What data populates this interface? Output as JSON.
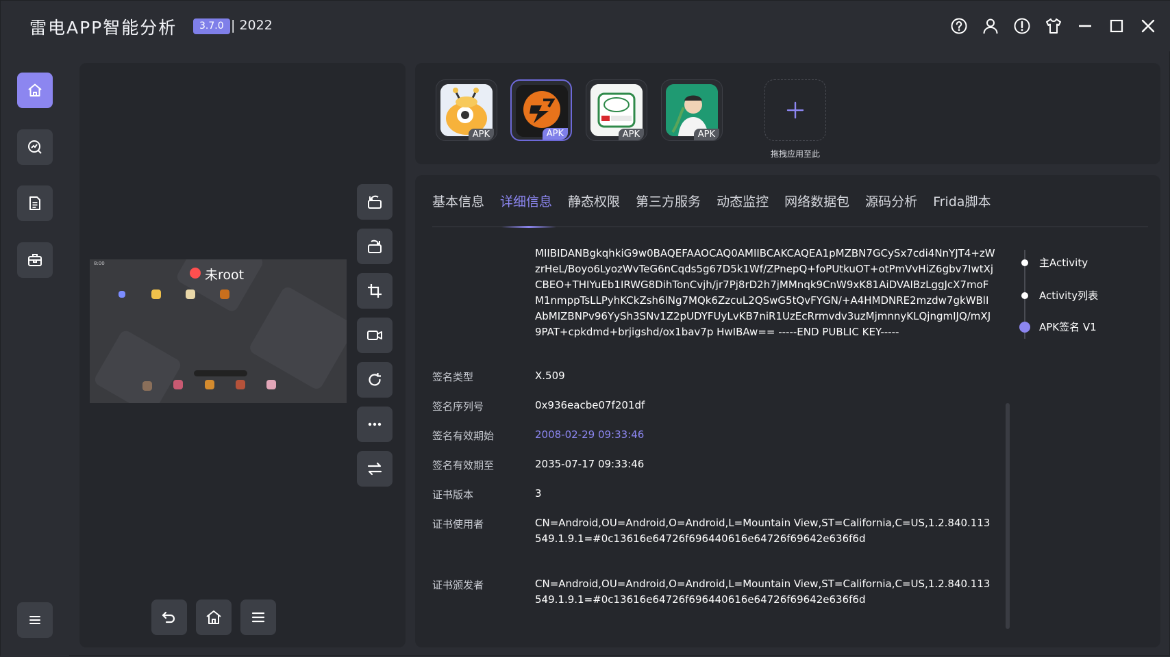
{
  "titlebar": {
    "title": "雷电APP智能分析",
    "version": "3.7.0",
    "year": "| 2022"
  },
  "sidebar": {
    "items": [
      {
        "icon": "home-icon",
        "active": true
      },
      {
        "icon": "analysis-icon",
        "active": false
      },
      {
        "icon": "document-icon",
        "active": false
      },
      {
        "icon": "toolbox-icon",
        "active": false
      }
    ],
    "menu_icon": "menu-icon"
  },
  "device": {
    "root_status": "未root",
    "status_bar_time": "8:00",
    "tools": [
      "rotate-left-icon",
      "rotate-right-icon",
      "crop-icon",
      "record-icon",
      "refresh-icon",
      "more-icon",
      "switch-icon"
    ],
    "nav": [
      "back-icon",
      "home-icon",
      "menu-icon"
    ]
  },
  "apk_bar": {
    "apps": [
      {
        "tag": "APK",
        "selected": false
      },
      {
        "tag": "APK",
        "selected": true
      },
      {
        "tag": "APK",
        "selected": false
      },
      {
        "tag": "APK",
        "selected": false
      }
    ],
    "add_label": "拖拽应用至此"
  },
  "tabs": [
    "基本信息",
    "详细信息",
    "静态权限",
    "第三方服务",
    "动态监控",
    "网络数据包",
    "源码分析",
    "Frida脚本"
  ],
  "active_tab": "详细信息",
  "details": {
    "public_key": "MIIBIDANBgkqhkiG9w0BAQEFAAOCAQ0AMIIBCAKCAQEA1pMZBN7GCySx7cdi4NnYJT4+zWzrHeL/Boyo6LyozWvTeG6nCqds5g67D5k1Wf/ZPnepQ+foPUtkuOT+otPmVvHiZ6gbv7IwtXjCBEO+THIYuEb1IRWG8DihTonCvjh/jr7Pj8rD2h7jMMnqk9CnW9xK81AiDVAIBzLggJcX7moFM1nmppTsLLPyhKCkZsh6lNg7MQk6ZzcuL2QSwG5tQvFYGN/+A4HMDNRE2mzdw7gkWBlIAbMIZBNPv96YySh3SNv1Z2pUDYFUyLvKB7niR1UzEcRrmvdv3uzMjmnnyKLQjngmIJQ/mXJ9PAT+cpkdmd+brjigshd/ox1bav7p HwIBAw== -----END PUBLIC KEY-----",
    "rows": [
      {
        "label": "签名类型",
        "value": "X.509"
      },
      {
        "label": "签名序列号",
        "value": "0x936eacbe07f201df"
      },
      {
        "label": "签名有效期始",
        "value": "2008-02-29 09:33:46"
      },
      {
        "label": "签名有效期至",
        "value": "2035-07-17 09:33:46"
      },
      {
        "label": "证书版本",
        "value": "3"
      },
      {
        "label": "证书使用者",
        "value": "CN=Android,OU=Android,O=Android,L=Mountain View,ST=California,C=US,1.2.840.113549.1.9.1=#0c13616e64726f696440616e64726f69642e636f6d"
      },
      {
        "label": "证书颁发者",
        "value": "CN=Android,OU=Android,O=Android,L=Mountain View,ST=California,C=US,1.2.840.113549.1.9.1=#0c13616e64726f696440616e64726f69642e636f6d"
      }
    ]
  },
  "timeline": [
    {
      "label": "主Activity",
      "active": false
    },
    {
      "label": "Activity列表",
      "active": false
    },
    {
      "label": "APK签名 V1",
      "active": true
    }
  ],
  "colors": {
    "accent": "#8c86f0",
    "version_badge": "#7f7fe9",
    "root_dot": "#ff4f4f",
    "background": "#2b2d33",
    "panel": "#25272c"
  }
}
